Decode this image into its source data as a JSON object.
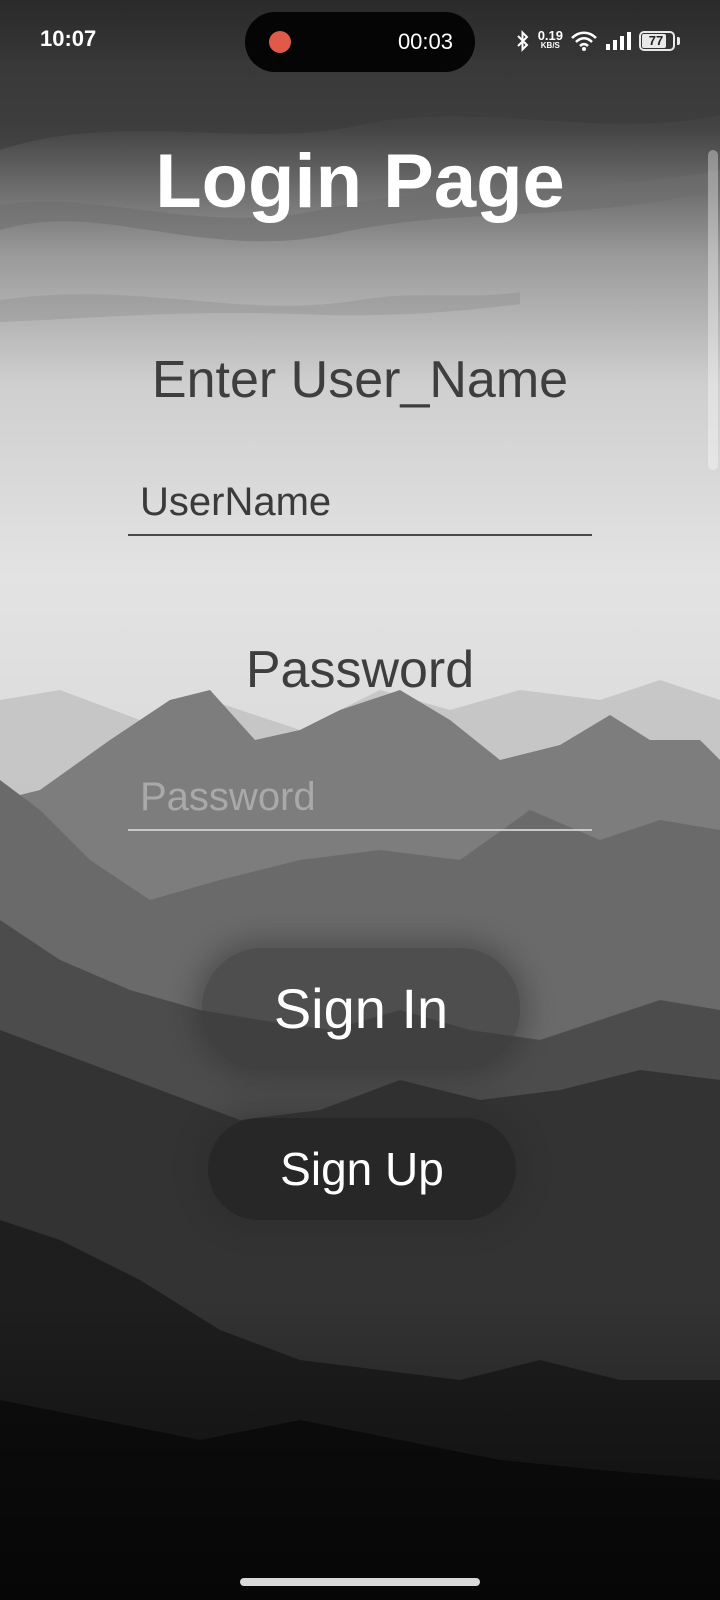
{
  "status_bar": {
    "time": "10:07",
    "recording_time": "00:03",
    "network_speed_value": "0.19",
    "network_speed_unit": "KB/S",
    "battery_level": "77",
    "recording_dot_color": "#e05a4a",
    "icons": [
      "bluetooth-icon",
      "wifi-icon",
      "signal-icon",
      "battery-icon"
    ]
  },
  "page": {
    "title": "Login Page",
    "username_label": "Enter User_Name",
    "username_value": "UserName",
    "password_label": "Password",
    "password_placeholder": "Password",
    "sign_in_label": "Sign In",
    "sign_up_label": "Sign Up"
  },
  "colors": {
    "title": "#ffffff",
    "label": "#3e3e3e",
    "button_text": "#ffffff"
  }
}
